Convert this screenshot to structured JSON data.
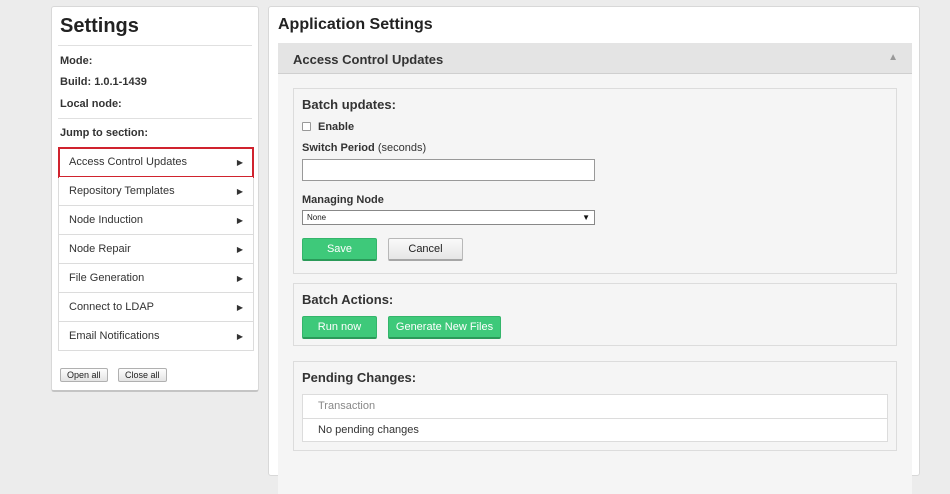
{
  "sidebar": {
    "title": "Settings",
    "mode_label": "Mode:",
    "build_label": "Build: 1.0.1-1439",
    "local_node_label": "Local node:",
    "jump_label": "Jump to section:",
    "items": [
      {
        "label": "Access Control Updates"
      },
      {
        "label": "Repository Templates"
      },
      {
        "label": "Node Induction"
      },
      {
        "label": "Node Repair"
      },
      {
        "label": "File Generation"
      },
      {
        "label": "Connect to LDAP"
      },
      {
        "label": "Email Notifications"
      }
    ],
    "arrow_glyph": "▶",
    "open_all": "Open all",
    "close_all": "Close all"
  },
  "main": {
    "title": "Application Settings",
    "section": {
      "title": "Access Control Updates",
      "toggle_glyph": "▲",
      "batch_updates": {
        "title": "Batch updates:",
        "enable_label": "Enable",
        "enable_checked": false,
        "switch_period_label": "Switch Period",
        "switch_period_hint": "(seconds)",
        "switch_period_value": "",
        "managing_node_label": "Managing Node",
        "managing_node_value": "None",
        "select_arrow_glyph": "▼",
        "save_label": "Save",
        "cancel_label": "Cancel"
      },
      "batch_actions": {
        "title": "Batch Actions:",
        "run_now_label": "Run now",
        "generate_label": "Generate New Files"
      },
      "pending_changes": {
        "title": "Pending Changes:",
        "column_header": "Transaction",
        "empty_text": "No pending changes"
      }
    }
  },
  "colors": {
    "accent_green": "#3ec97a",
    "active_outline": "#d0232e",
    "background": "#ececec"
  }
}
